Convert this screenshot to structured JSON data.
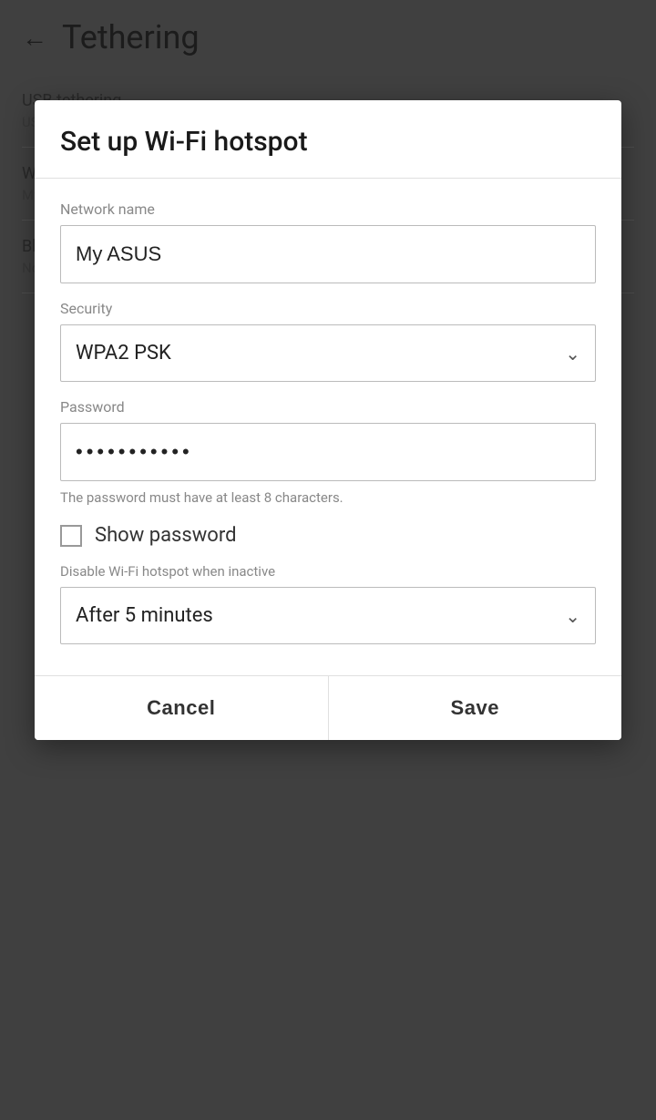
{
  "page": {
    "title": "Tethering",
    "back_icon": "←"
  },
  "background": {
    "items": [
      {
        "label": "USB tethering",
        "sub": "USB connected"
      },
      {
        "label": "Wi-Fi hotspot",
        "sub": "My ASUS"
      },
      {
        "label": "Bluetooth tethering",
        "sub": "Not connected"
      }
    ]
  },
  "dialog": {
    "title": "Set up Wi-Fi hotspot",
    "network_name_label": "Network name",
    "network_name_value": "My ASUS",
    "security_label": "Security",
    "security_value": "WPA2 PSK",
    "password_label": "Password",
    "password_dots": "• • • • • • • • • • • •",
    "password_hint": "The password must have at least 8 characters.",
    "show_password_label": "Show password",
    "disable_label": "Disable Wi-Fi hotspot when inactive",
    "disable_value": "After 5 minutes",
    "cancel_label": "Cancel",
    "save_label": "Save",
    "chevron": "⌄"
  }
}
